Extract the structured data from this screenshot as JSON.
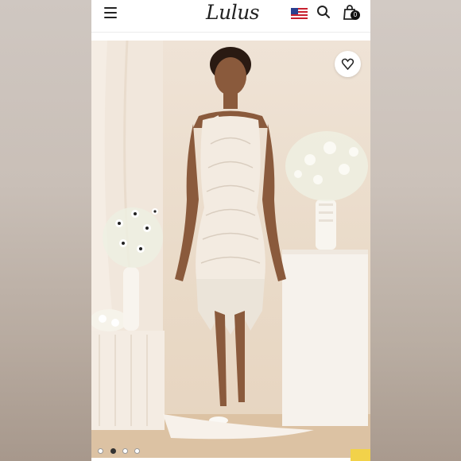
{
  "header": {
    "menu_icon": "hamburger-menu-icon",
    "logo_text": "Lulus",
    "flag_icon": "us-flag-icon",
    "search_icon": "search-icon",
    "bag_icon": "shopping-bag-icon",
    "bag_count": "0"
  },
  "product": {
    "wishlist_icon": "heart-icon",
    "image_dots": [
      {
        "active": false
      },
      {
        "active": true
      },
      {
        "active": false
      },
      {
        "active": false
      }
    ]
  },
  "colors": {
    "background_side": "#c9bfb7",
    "hero_bg": "#eadbc9",
    "accent_tab": "#f2d24a"
  }
}
